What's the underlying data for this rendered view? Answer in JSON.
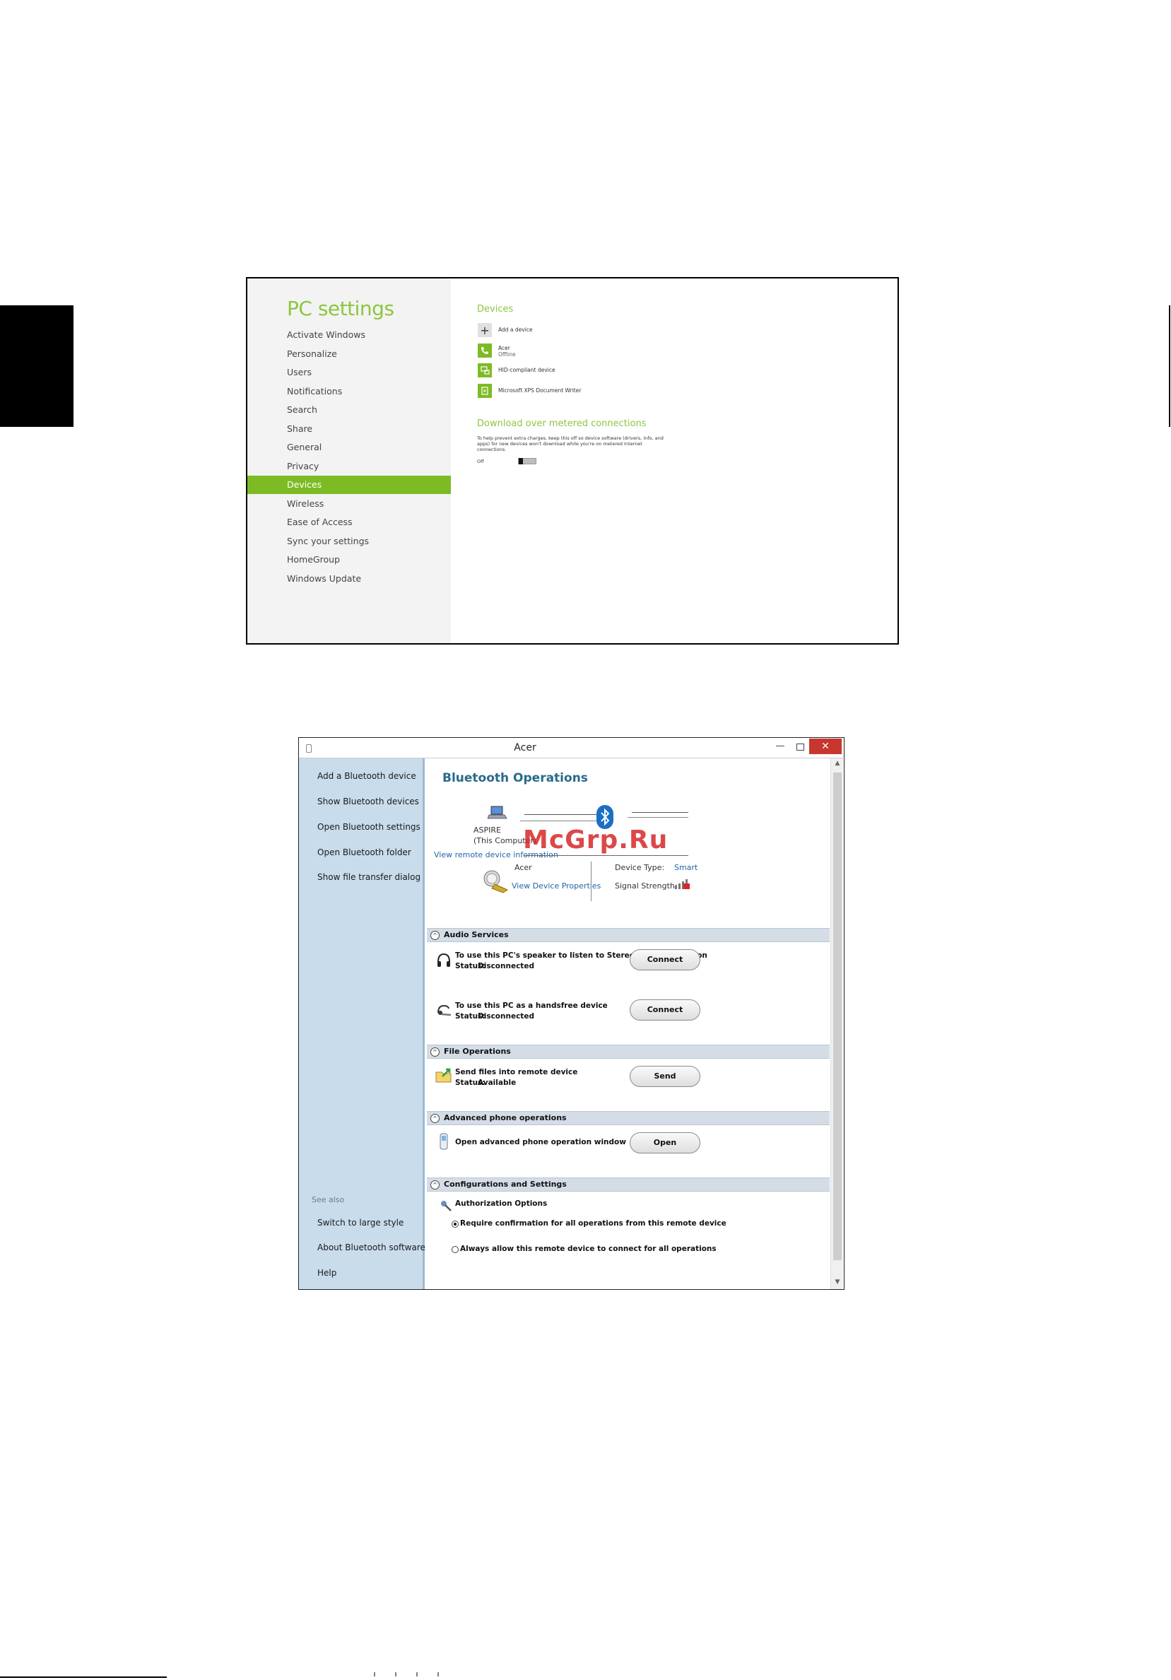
{
  "pc_settings": {
    "title": "PC settings",
    "nav": [
      {
        "label": "Activate Windows",
        "selected": false
      },
      {
        "label": "Personalize",
        "selected": false
      },
      {
        "label": "Users",
        "selected": false
      },
      {
        "label": "Notifications",
        "selected": false
      },
      {
        "label": "Search",
        "selected": false
      },
      {
        "label": "Share",
        "selected": false
      },
      {
        "label": "General",
        "selected": false
      },
      {
        "label": "Privacy",
        "selected": false
      },
      {
        "label": "Devices",
        "selected": true
      },
      {
        "label": "Wireless",
        "selected": false
      },
      {
        "label": "Ease of Access",
        "selected": false
      },
      {
        "label": "Sync your settings",
        "selected": false
      },
      {
        "label": "HomeGroup",
        "selected": false
      },
      {
        "label": "Windows Update",
        "selected": false
      }
    ],
    "devices_heading": "Devices",
    "add_device_label": "Add a device",
    "devices": [
      {
        "name": "Acer",
        "status": "Offline",
        "icon": "phone-icon"
      },
      {
        "name": "HID-compliant device",
        "status": "",
        "icon": "hid-device-icon"
      },
      {
        "name": "Microsoft XPS Document Writer",
        "status": "",
        "icon": "printer-icon"
      }
    ],
    "metered_heading": "Download over metered connections",
    "metered_desc_1": "To help prevent extra charges, keep this off so device software (drivers, info, and",
    "metered_desc_2": "apps) for new devices won't download while you're on metered Internet",
    "metered_desc_3": "connections.",
    "toggle_label": "Off",
    "toggle_on": false,
    "accent_color": "#7dbb24"
  },
  "bluetooth": {
    "window_title": "Acer",
    "close_glyph": "✕",
    "min_glyph": "—",
    "sidebar_links": [
      "Add a Bluetooth device",
      "Show Bluetooth devices",
      "Open Bluetooth settings",
      "Open Bluetooth folder",
      "Show file transfer dialog"
    ],
    "see_also_label": "See also",
    "see_also_links": [
      "Switch to large style",
      "About Bluetooth software",
      "Help"
    ],
    "heading": "Bluetooth Operations",
    "computer_name": "ASPIRE",
    "computer_sub": "(This Computer)",
    "view_remote_link": "View remote device information",
    "remote_name": "Acer",
    "view_props_link": "View Device Properties",
    "device_type_label": "Device Type:",
    "device_type_value": "Smart",
    "signal_label": "Signal Strength:",
    "sections": {
      "audio": "Audio Services",
      "file": "File Operations",
      "phone": "Advanced phone operations",
      "config": "Configurations and Settings"
    },
    "audio_items": [
      {
        "text": "To use this PC's speaker to listen to Stereo Audio playing on",
        "status_label": "Status:",
        "status": "Disconnected",
        "button": "Connect"
      },
      {
        "text": "To use this PC as a handsfree device",
        "status_label": "Status:",
        "status": "Disconnected",
        "button": "Connect"
      }
    ],
    "file_item": {
      "text": "Send files into remote device",
      "status_label": "Status:",
      "status": "Available",
      "button": "Send"
    },
    "phone_item": {
      "text": "Open advanced phone operation window",
      "button": "Open"
    },
    "auth_title": "Authorization Options",
    "auth_options": [
      {
        "label": "Require confirmation for all operations from this remote device",
        "selected": true
      },
      {
        "label": "Always allow this remote device to connect for all operations",
        "selected": false
      }
    ],
    "sidebar_color": "#c8dcec",
    "close_color": "#c7372d"
  },
  "watermark": "McGrp.Ru"
}
